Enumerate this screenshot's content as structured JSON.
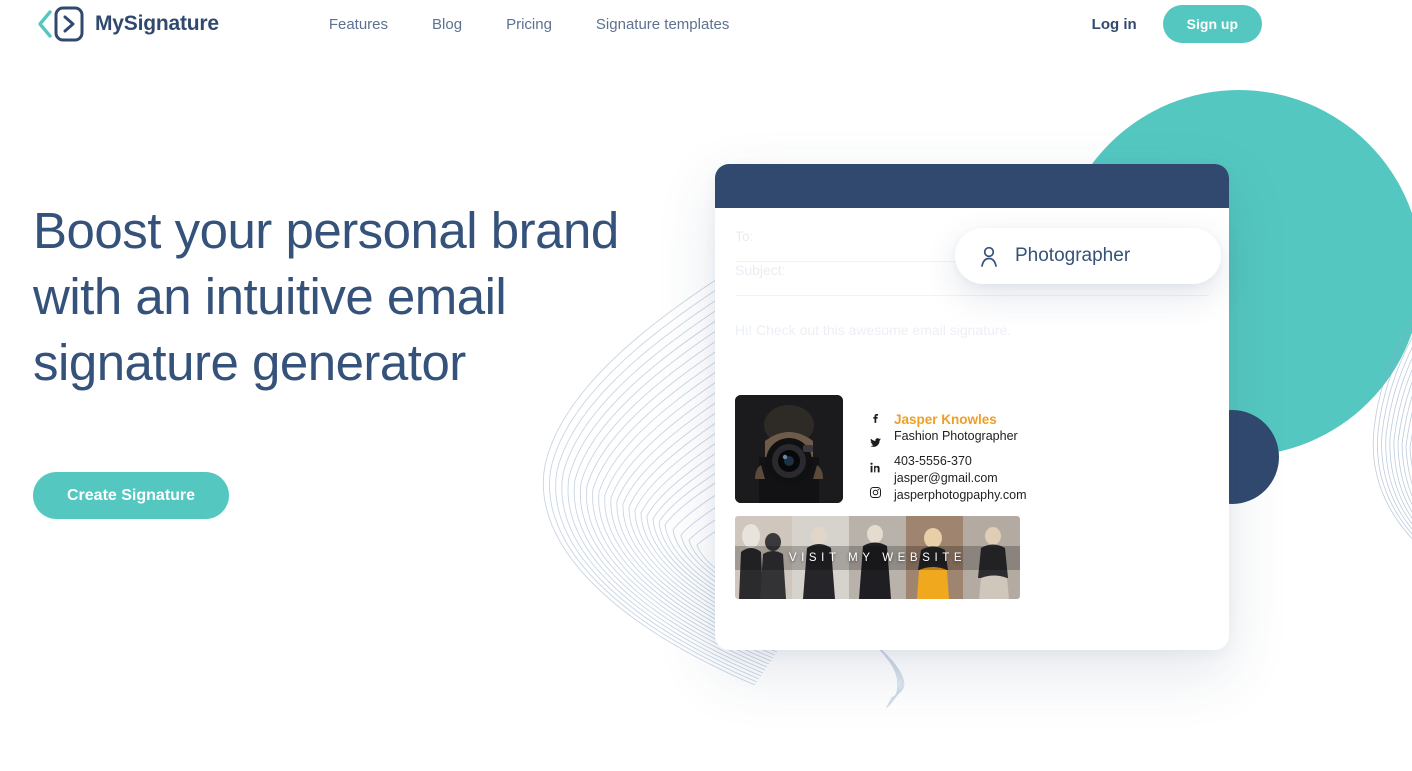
{
  "header": {
    "brand_name": "MySignature",
    "logo_icon": "chevron-envelope-logo-icon",
    "nav": [
      {
        "label": "Features"
      },
      {
        "label": "Blog"
      },
      {
        "label": "Pricing"
      },
      {
        "label": "Signature templates"
      }
    ],
    "login_label": "Log in",
    "signup_label": "Sign up"
  },
  "hero": {
    "title": "Boost your personal brand with an intuitive email signature generator",
    "cta_label": "Create Signature"
  },
  "mail_mock": {
    "to_label": "To:",
    "subject_label": "Subject:",
    "greeting": "Hi! Check out this awesome email signature.",
    "signature": {
      "name": "Jasper Knowles",
      "role": "Fashion Photographer",
      "phone": "403-5556-370",
      "email": "jasper@gmail.com",
      "website": "jasperphotogpaphy.com",
      "socials": [
        "facebook-icon",
        "twitter-icon",
        "linkedin-icon",
        "instagram-icon"
      ],
      "avatar_alt": "photographer-portrait",
      "banner_text": "VISIT MY WEBSITE",
      "banner_alt": "fashion-photo-collage"
    }
  },
  "role_pill": {
    "icon": "user-icon",
    "label": "Photographer"
  },
  "colors": {
    "accent_teal": "#54c8c0",
    "navy": "#31496e",
    "heading": "#35527a",
    "nav_text": "#5d7290",
    "signature_orange": "#ef9f24",
    "page_bg": "#ffffff"
  }
}
